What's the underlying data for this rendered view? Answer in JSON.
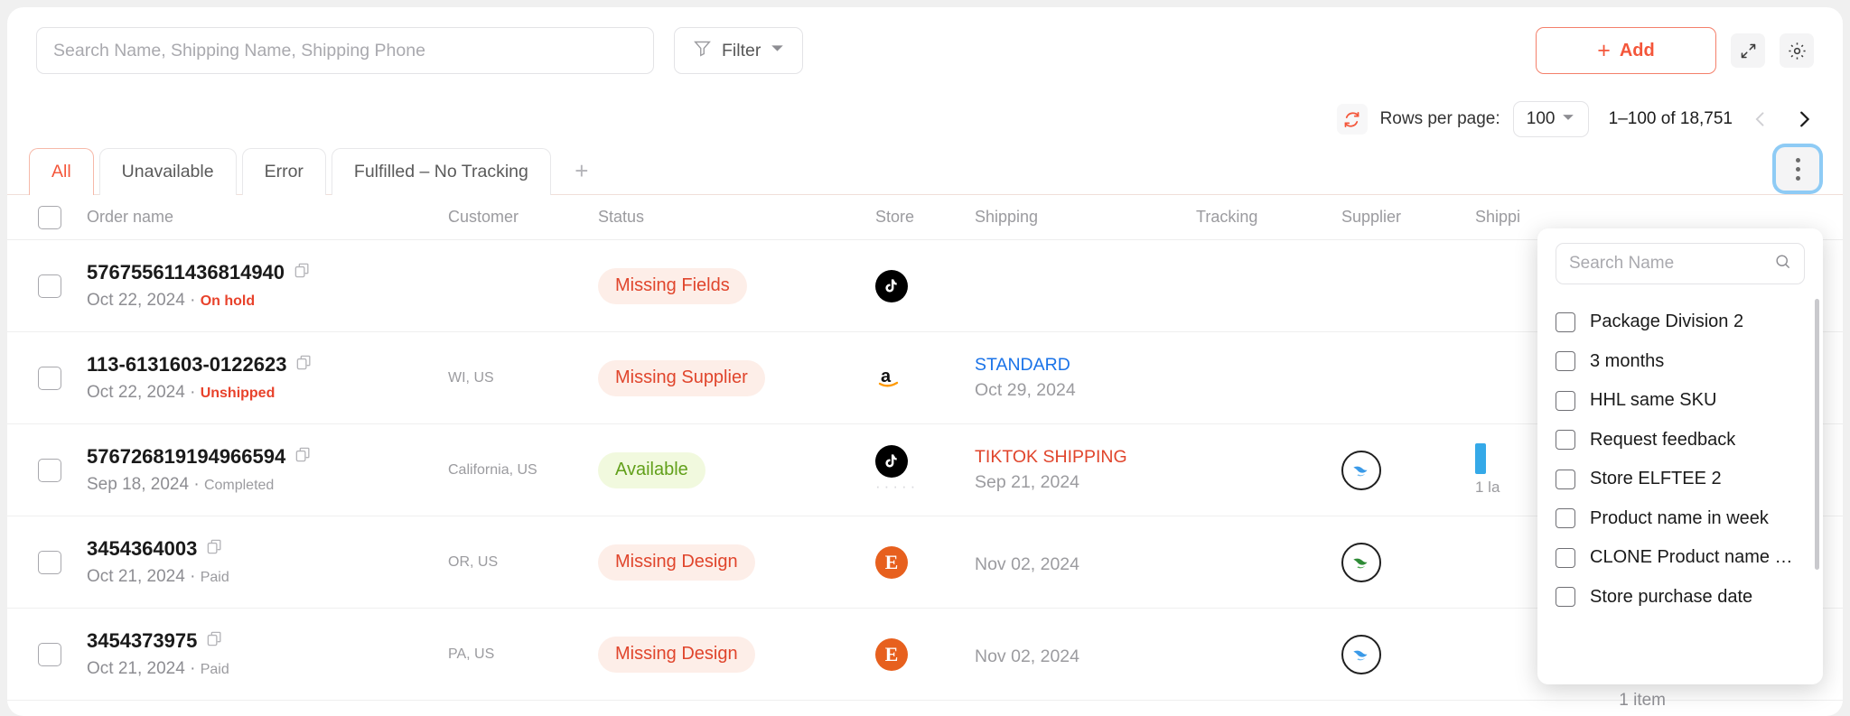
{
  "toolbar": {
    "search_placeholder": "Search Name, Shipping Name, Shipping Phone",
    "search_value": "",
    "filter_label": "Filter",
    "add_label": "Add",
    "add_plus": "+",
    "expand_icon": "expand-icon",
    "settings_icon": "gear-icon",
    "accent_color": "#f4563a"
  },
  "pagination": {
    "refresh_icon": "refresh-icon",
    "rows_per_page_label": "Rows per page:",
    "rows_per_page_value": "100",
    "range_label": "1–100 of 18,751",
    "prev_label": "‹",
    "next_label": "›"
  },
  "tabs": {
    "items": [
      {
        "label": "All",
        "active": true
      },
      {
        "label": "Unavailable",
        "active": false
      },
      {
        "label": "Error",
        "active": false
      },
      {
        "label": "Fulfilled – No Tracking",
        "active": false
      }
    ],
    "add_tab_label": "+",
    "kebab_name": "more-options"
  },
  "table": {
    "headers": {
      "order": "Order name",
      "customer": "Customer",
      "status": "Status",
      "store": "Store",
      "shipping": "Shipping",
      "tracking": "Tracking",
      "supplier": "Supplier",
      "shipping2": "Shippi"
    },
    "rows": [
      {
        "order": "576755611436814940",
        "date": "Oct 22, 2024",
        "state": "On hold",
        "state_class": "onhold",
        "customer": "",
        "status": "Missing Fields",
        "status_tone": "red",
        "store": "tiktok",
        "ship_method": "",
        "ship_method_tone": "",
        "ship_date": "",
        "tracking": "",
        "supplier": ""
      },
      {
        "order": "113-6131603-0122623",
        "date": "Oct 22, 2024",
        "state": "Unshipped",
        "state_class": "unshipped",
        "customer": "WI, US",
        "status": "Missing Supplier",
        "status_tone": "red",
        "store": "amazon",
        "ship_method": "STANDARD",
        "ship_method_tone": "blue",
        "ship_date": "Oct 29, 2024",
        "tracking": "",
        "supplier": ""
      },
      {
        "order": "576726819194966594",
        "date": "Sep 18, 2024",
        "state": "Completed",
        "state_class": "completed",
        "customer": "California, US",
        "status": "Available",
        "status_tone": "green",
        "store": "tiktok",
        "ship_method": "TIKTOK SHIPPING",
        "ship_method_tone": "red",
        "ship_date": "Sep 21, 2024",
        "tracking": "1 la",
        "supplier": "blue"
      },
      {
        "order": "3454364003",
        "date": "Oct 21, 2024",
        "state": "Paid",
        "state_class": "paid",
        "customer": "OR, US",
        "status": "Missing Design",
        "status_tone": "red",
        "store": "etsy",
        "ship_method": "",
        "ship_method_tone": "",
        "ship_date": "Nov 02, 2024",
        "tracking": "",
        "supplier": "green"
      },
      {
        "order": "3454373975",
        "date": "Oct 21, 2024",
        "state": "Paid",
        "state_class": "paid",
        "customer": "PA, US",
        "status": "Missing Design",
        "status_tone": "red",
        "store": "etsy",
        "ship_method": "",
        "ship_method_tone": "",
        "ship_date": "Nov 02, 2024",
        "tracking": "",
        "supplier": "blue"
      }
    ],
    "copy_icon": "copy-icon"
  },
  "dropdown": {
    "search_placeholder": "Search Name",
    "search_value": "",
    "search_icon": "search-icon",
    "options": [
      {
        "label": "Package Division 2",
        "checked": false
      },
      {
        "label": "3 months",
        "checked": false
      },
      {
        "label": "HHL same SKU",
        "checked": false
      },
      {
        "label": "Request feedback",
        "checked": false
      },
      {
        "label": "Store ELFTEE 2",
        "checked": false
      },
      {
        "label": "Product name in week",
        "checked": false
      },
      {
        "label": "CLONE Product name …",
        "checked": false
      },
      {
        "label": "Store purchase date",
        "checked": false
      }
    ]
  },
  "footer": {
    "item_count": "1 item"
  }
}
